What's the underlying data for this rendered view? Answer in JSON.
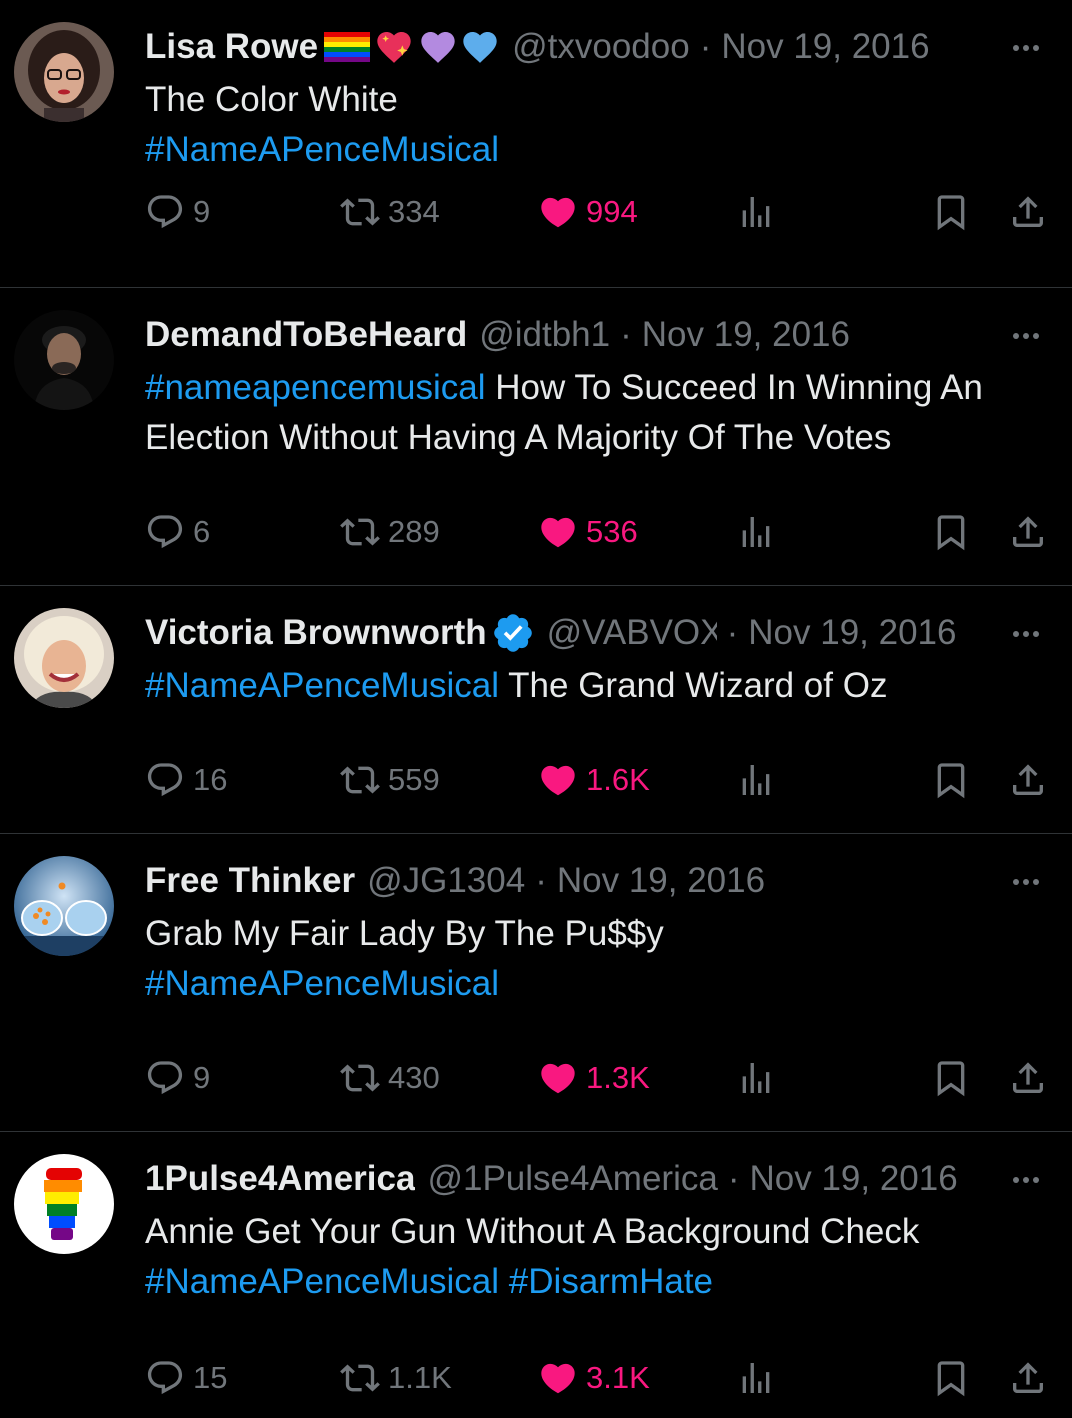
{
  "colors": {
    "background": "#000000",
    "text": "#e7e9ea",
    "secondary": "#71767b",
    "link": "#1d9bf0",
    "like": "#f91880",
    "divider": "#2f3336",
    "verified": "#1d9bf0"
  },
  "tweets": [
    {
      "name": "Lisa Rowe",
      "name_emoji": [
        "rainbow-flag-icon",
        "sparkling-heart-icon",
        "purple-heart-icon",
        "blue-heart-icon"
      ],
      "handle": "@txvoodoo",
      "separator": "·",
      "date": "Nov 19, 2016",
      "text_line1": "The Color White",
      "hashtag": "#NameAPenceMusical",
      "replies": "9",
      "reposts": "334",
      "likes": "994"
    },
    {
      "name": "DemandToBeHeard",
      "handle": "@idtbh1",
      "separator": "·",
      "date": "Nov 19, 2016",
      "hashtag": "#nameapencemusical",
      "text": " How To Succeed In Winning An Election Without Having A Majority Of The Votes",
      "replies": "6",
      "reposts": "289",
      "likes": "536"
    },
    {
      "name": "Victoria Brownworth",
      "verified": "verified-badge-icon",
      "handle": "@VABVOX",
      "separator": "·",
      "date": "Nov 19, 2016",
      "hashtag": "#NameAPenceMusical",
      "text": " The Grand Wizard of Oz",
      "replies": "16",
      "reposts": "559",
      "likes": "1.6K"
    },
    {
      "name": "Free Thinker",
      "handle": "@JG1304",
      "separator": "·",
      "date": "Nov 19, 2016",
      "text_line1": "Grab My Fair Lady By The Pu$$y",
      "hashtag": "#NameAPenceMusical",
      "replies": "9",
      "reposts": "430",
      "likes": "1.3K"
    },
    {
      "name": "1Pulse4America",
      "handle": "@1Pulse4America",
      "separator": "·",
      "date": "Nov 19, 2016",
      "text_line1": "Annie Get Your Gun Without A Background Check",
      "hashtag": "#NameAPenceMusical",
      "hashtag2": "#DisarmHate",
      "replies": "15",
      "reposts": "1.1K",
      "likes": "3.1K"
    }
  ]
}
